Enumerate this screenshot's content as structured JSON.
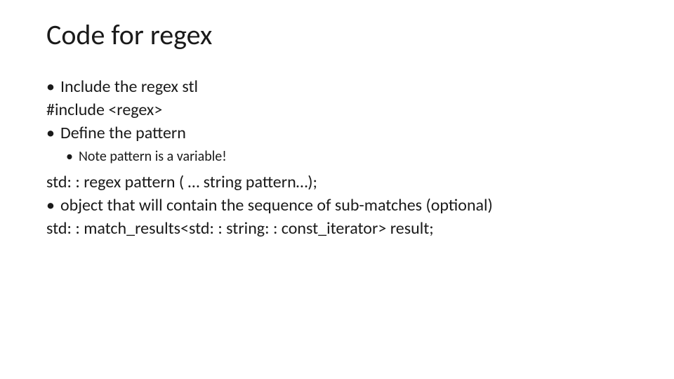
{
  "slide": {
    "title": "Code for regex",
    "lines": {
      "b1": "Include the regex stl",
      "code1": "#include <regex>",
      "b2": "Define the pattern",
      "sub1": "Note pattern is a variable!",
      "code2": "std: : regex pattern ( … string pattern…);",
      "b3": "object that will contain the sequence of sub-matches (optional)",
      "code3": "std: : match_results<std: : string: : const_iterator> result;"
    },
    "bullet_glyph": "•"
  }
}
